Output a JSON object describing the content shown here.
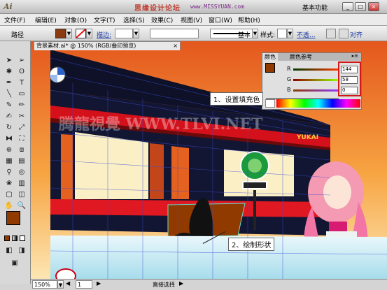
{
  "title_bar": {
    "app_logo": "Ai",
    "site_title": "思缘设计论坛",
    "site_url": "www.MISSYUAN.com",
    "workspace": "基本功能",
    "min_label": "_",
    "max_label": "□",
    "close_label": "×"
  },
  "menu": [
    "文件(F)",
    "编辑(E)",
    "对象(O)",
    "文字(T)",
    "选择(S)",
    "效果(C)",
    "视图(V)",
    "窗口(W)",
    "帮助(H)"
  ],
  "control_bar": {
    "path_label": "路径",
    "fill_color": "#8b3a12",
    "stroke_label": "描边:",
    "stroke_style": "基本",
    "style_label": "样式:",
    "opacity_label": "不透..."
  },
  "document_tab": {
    "label": "背景素材.ai* @ 150% (RGB/叠印预览)"
  },
  "color_panel": {
    "tab_color": "颜色",
    "tab_guide": "颜色参考",
    "r_label": "R",
    "g_label": "G",
    "b_label": "B",
    "r_value": "144",
    "g_value": "58",
    "b_value": "0",
    "fill_color": "#903a00"
  },
  "callouts": {
    "step1": "1、设置填充色",
    "step2": "2、绘制形状"
  },
  "watermark": "腾龍視覺 WWW.TLVI.NET",
  "store_sign": "YUKAI",
  "status": {
    "zoom": "150%",
    "page": "1",
    "mode": "直接选择"
  },
  "colors": {
    "accent_red": "#d01818",
    "building": "#121633",
    "sky": "#f39b3a"
  }
}
